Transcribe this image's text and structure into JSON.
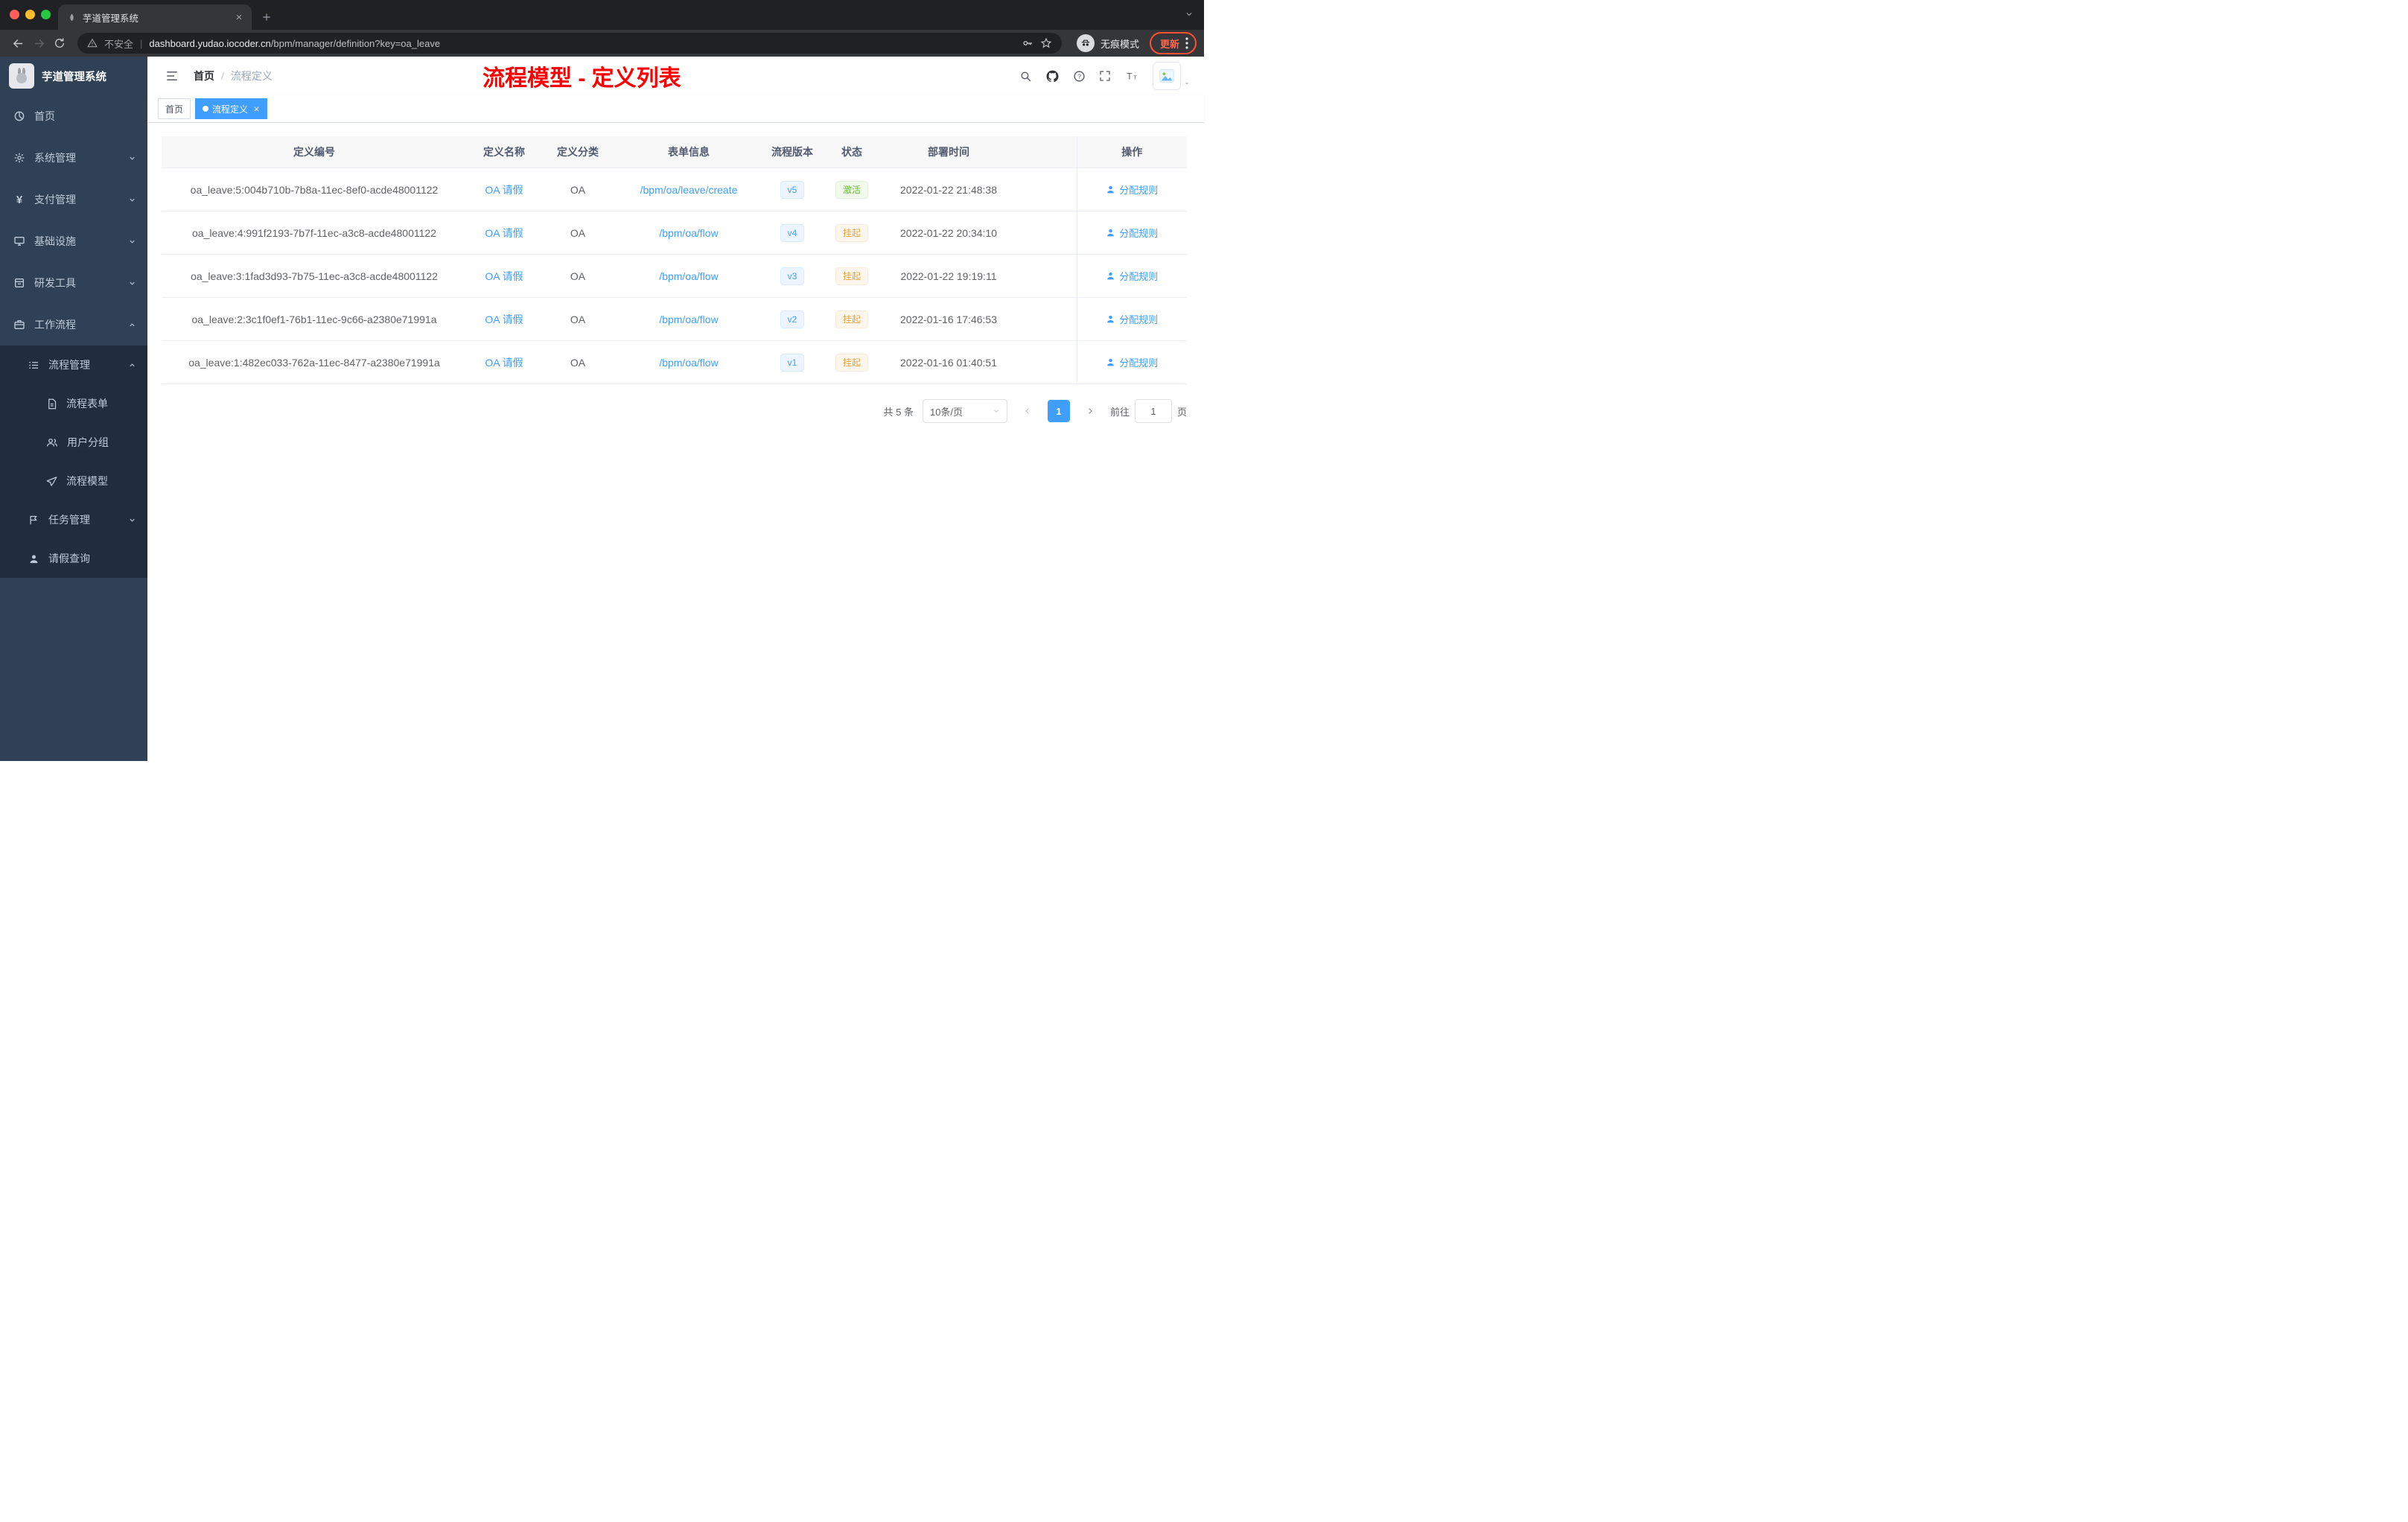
{
  "colors": {
    "accent": "#409eff",
    "success": "#67c23a",
    "warning": "#e6a23c",
    "annotation_red": "#ff0000",
    "sidebar_bg": "#304156",
    "submenu_bg": "#1f2d3d"
  },
  "browser": {
    "tab_title": "芋道管理系统",
    "security_label": "不安全",
    "url_domain": "dashboard.yudao.iocoder.cn",
    "url_path": "/bpm/manager/definition?key=oa_leave",
    "incognito_label": "无痕模式",
    "update_label": "更新",
    "icons": [
      "back",
      "forward",
      "reload",
      "warning",
      "key",
      "star",
      "incognito-spy",
      "more-dots"
    ]
  },
  "sidebar": {
    "logo_title": "芋道管理系统",
    "items": [
      {
        "label": "首页"
      },
      {
        "label": "系统管理"
      },
      {
        "label": "支付管理"
      },
      {
        "label": "基础设施"
      },
      {
        "label": "研发工具"
      },
      {
        "label": "工作流程"
      }
    ],
    "workflow_children": {
      "process_management": {
        "label": "流程管理",
        "children": [
          {
            "label": "流程表单"
          },
          {
            "label": "用户分组"
          },
          {
            "label": "流程模型"
          }
        ]
      },
      "task_management": {
        "label": "任务管理"
      },
      "leave_query": {
        "label": "请假查询"
      }
    }
  },
  "navbar": {
    "breadcrumb": [
      {
        "label": "首页"
      },
      {
        "label": "流程定义"
      }
    ],
    "separator": "/",
    "annotation": "流程模型 - 定义列表",
    "icons": [
      "search",
      "github",
      "question",
      "fullscreen",
      "font-size",
      "avatar"
    ]
  },
  "tags": {
    "items": [
      {
        "label": "首页",
        "active": false
      },
      {
        "label": "流程定义",
        "active": true
      }
    ]
  },
  "table": {
    "columns": [
      "定义编号",
      "定义名称",
      "定义分类",
      "表单信息",
      "流程版本",
      "状态",
      "部署时间",
      "操作"
    ],
    "rows": [
      {
        "id": "oa_leave:5:004b710b-7b8a-11ec-8ef0-acde48001122",
        "name": "OA 请假",
        "category": "OA",
        "form": "/bpm/oa/leave/create",
        "version": "v5",
        "status": "激活",
        "status_type": "success",
        "deploy_time": "2022-01-22 21:48:38",
        "action": "分配规则"
      },
      {
        "id": "oa_leave:4:991f2193-7b7f-11ec-a3c8-acde48001122",
        "name": "OA 请假",
        "category": "OA",
        "form": "/bpm/oa/flow",
        "version": "v4",
        "status": "挂起",
        "status_type": "warning",
        "deploy_time": "2022-01-22 20:34:10",
        "action": "分配规则"
      },
      {
        "id": "oa_leave:3:1fad3d93-7b75-11ec-a3c8-acde48001122",
        "name": "OA 请假",
        "category": "OA",
        "form": "/bpm/oa/flow",
        "version": "v3",
        "status": "挂起",
        "status_type": "warning",
        "deploy_time": "2022-01-22 19:19:11",
        "action": "分配规则"
      },
      {
        "id": "oa_leave:2:3c1f0ef1-76b1-11ec-9c66-a2380e71991a",
        "name": "OA 请假",
        "category": "OA",
        "form": "/bpm/oa/flow",
        "version": "v2",
        "status": "挂起",
        "status_type": "warning",
        "deploy_time": "2022-01-16 17:46:53",
        "action": "分配规则"
      },
      {
        "id": "oa_leave:1:482ec033-762a-11ec-8477-a2380e71991a",
        "name": "OA 请假",
        "category": "OA",
        "form": "/bpm/oa/flow",
        "version": "v1",
        "status": "挂起",
        "status_type": "warning",
        "deploy_time": "2022-01-16 01:40:51",
        "action": "分配规则"
      }
    ]
  },
  "pagination": {
    "total": "共 5 条",
    "page_size": "10条/页",
    "current_page": "1",
    "goto_label": "前往",
    "goto_value": "1",
    "unit_label": "页"
  }
}
